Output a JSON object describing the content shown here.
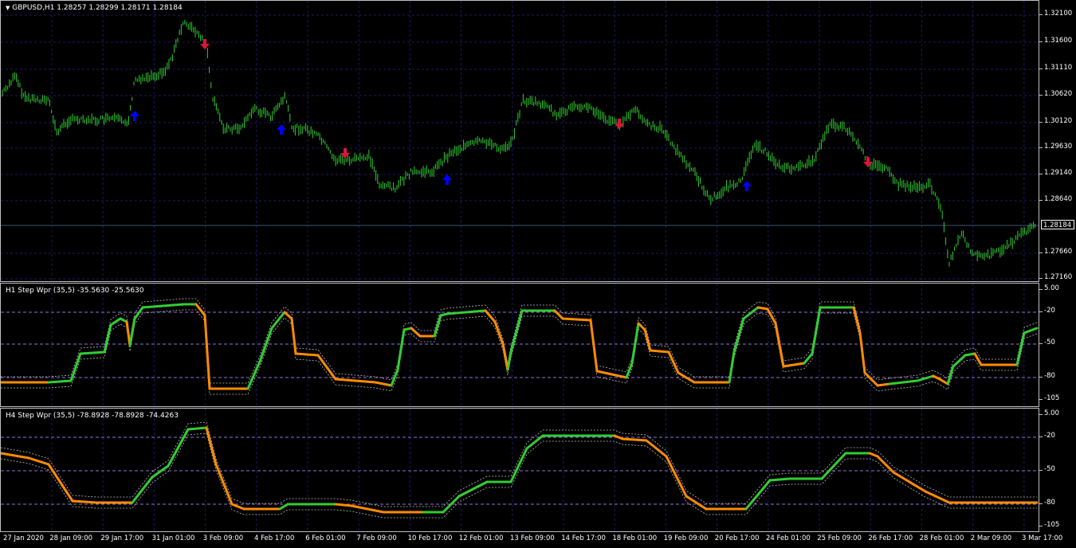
{
  "main": {
    "menu_arrow": "▼",
    "label": "GBPUSD,H1  1.28257 1.28299 1.28171 1.28184",
    "price_axis": [
      "1.32100",
      "1.31600",
      "1.31110",
      "1.30620",
      "1.30120",
      "1.29630",
      "1.29140",
      "1.28640",
      "1.28184",
      "1.27660",
      "1.27160"
    ],
    "current_price": "1.28184",
    "colors": {
      "bars": "#32cd32",
      "grid": "#1a1a66",
      "up_arrow": "#0000ff",
      "down_arrow": "#dc143c",
      "current_line": "#3d4f73"
    }
  },
  "indicator1": {
    "label": "H1 Step Wpr (35,5) -35.5630 -25.5630",
    "levels": [
      "5.00",
      "-20",
      "-50",
      "-80",
      "-105"
    ],
    "colors": {
      "up": "#32cd32",
      "down": "#ff8c00",
      "bands": "#c0c0c0",
      "levels": "#9370db"
    }
  },
  "indicator2": {
    "label": "H4 Step Wpr (35,5) -78.8928 -78.8928 -74.4263",
    "levels": [
      "5.00",
      "-20",
      "-50",
      "-80",
      "-105"
    ],
    "colors": {
      "up": "#32cd32",
      "down": "#ff8c00",
      "bands": "#c0c0c0",
      "levels": "#9370db"
    }
  },
  "time_axis": [
    "27 Jan 2020",
    "28 Jan 09:00",
    "29 Jan 17:00",
    "31 Jan 01:00",
    "3 Feb 09:00",
    "4 Feb 17:00",
    "6 Feb 01:00",
    "7 Feb 09:00",
    "10 Feb 17:00",
    "12 Feb 01:00",
    "13 Feb 09:00",
    "14 Feb 17:00",
    "18 Feb 01:00",
    "19 Feb 09:00",
    "20 Feb 17:00",
    "24 Feb 01:00",
    "25 Feb 09:00",
    "26 Feb 17:00",
    "28 Feb 01:00",
    "2 Mar 09:00",
    "3 Mar 17:00"
  ]
}
